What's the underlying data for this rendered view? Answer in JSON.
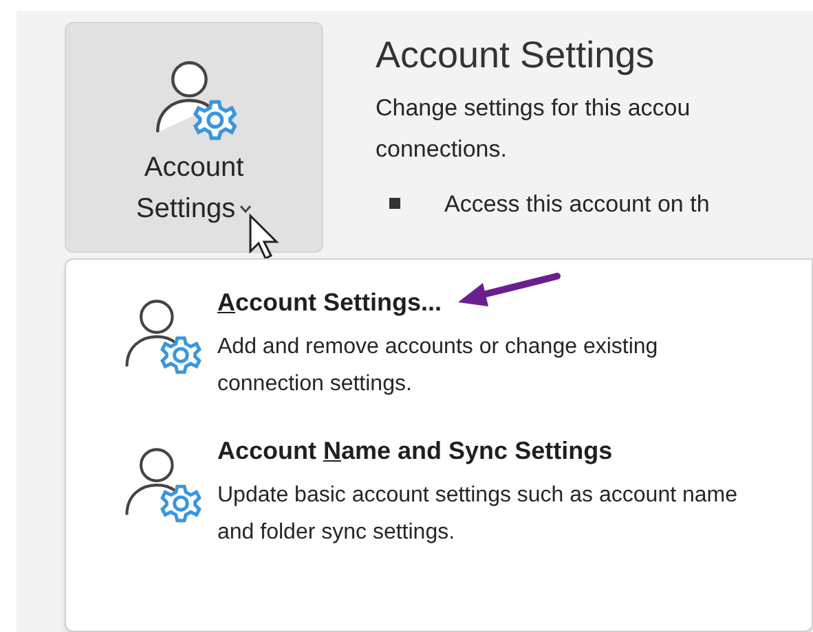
{
  "ribbon_button": {
    "label_line_1": "Account",
    "label_line_2": "Settings",
    "has_dropdown": true,
    "selected": true
  },
  "info": {
    "title": "Account Settings",
    "description": "Change settings for this accou",
    "description_line_2": "connections.",
    "bullets": [
      {
        "text": "Access this account on th"
      }
    ]
  },
  "menu": {
    "items": [
      {
        "label": {
          "key": "A",
          "after": "ccount Settings..."
        },
        "description": "Add and remove accounts or change existing connection settings.",
        "annotated": true
      },
      {
        "label": {
          "before": "Account ",
          "key": "N",
          "after": "ame and Sync Settings"
        },
        "description": "Update basic account settings such as account name and folder sync settings.",
        "annotated": false
      }
    ]
  }
}
